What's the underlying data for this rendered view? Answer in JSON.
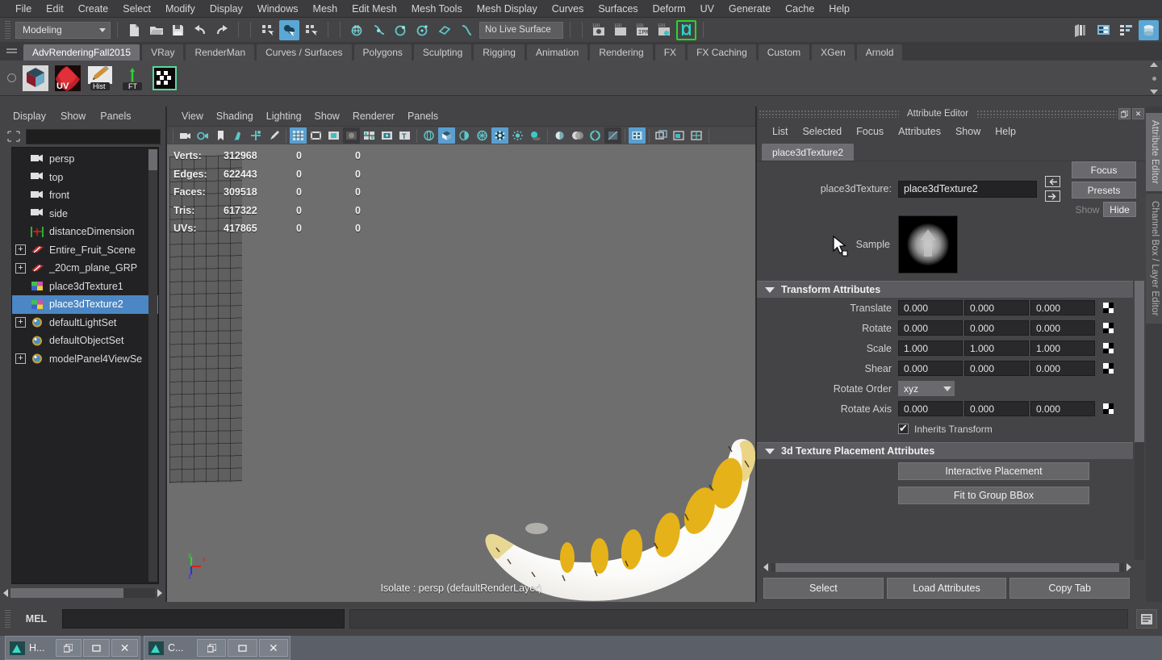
{
  "menubar": {
    "items": [
      "File",
      "Edit",
      "Create",
      "Select",
      "Modify",
      "Display",
      "Windows",
      "Mesh",
      "Edit Mesh",
      "Mesh Tools",
      "Mesh Display",
      "Curves",
      "Surfaces",
      "Deform",
      "UV",
      "Generate",
      "Cache",
      "Help"
    ]
  },
  "statusline": {
    "mode": "Modeling",
    "live_surface": "No Live Surface",
    "icons": [
      "new-scene-icon",
      "open-scene-icon",
      "save-scene-icon",
      "undo-icon",
      "redo-icon",
      "select-by-hierarchy-icon",
      "select-by-object-icon",
      "select-by-component-icon",
      "snap-to-grid-icon",
      "snap-to-curve-icon",
      "snap-to-point-icon",
      "snap-to-projected-center-icon",
      "snap-to-view-plane-icon",
      "make-live-icon",
      "render-current-frame-icon",
      "render-settings-icon",
      "ipr-render-icon",
      "render-view-icon",
      "hypershade-icon",
      "toggle-sidebar-icon",
      "attribute-editor-toggle-icon",
      "channel-box-toggle-icon",
      "layer-editor-toggle-icon"
    ]
  },
  "shelf": {
    "tabs": [
      "AdvRenderingFall2015",
      "VRay",
      "RenderMan",
      "Curves / Surfaces",
      "Polygons",
      "Sculpting",
      "Rigging",
      "Animation",
      "Rendering",
      "FX",
      "FX Caching",
      "Custom",
      "XGen",
      "Arnold"
    ],
    "active_tab": "AdvRenderingFall2015",
    "buttons": [
      "cube-shader-icon",
      "uv-texture-icon",
      "hist-pencil-icon",
      "ft-axis-icon",
      "checker-texture-icon"
    ]
  },
  "outliner": {
    "menus": [
      "Display",
      "Show",
      "Panels"
    ],
    "search_value": "",
    "items": [
      {
        "label": "persp",
        "icon": "camera-icon",
        "expandable": false,
        "indent": 1,
        "selected": false
      },
      {
        "label": "top",
        "icon": "camera-icon",
        "expandable": false,
        "indent": 1,
        "selected": false
      },
      {
        "label": "front",
        "icon": "camera-icon",
        "expandable": false,
        "indent": 1,
        "selected": false
      },
      {
        "label": "side",
        "icon": "camera-icon",
        "expandable": false,
        "indent": 1,
        "selected": false
      },
      {
        "label": "distanceDimension",
        "icon": "distance-dimension-icon",
        "expandable": false,
        "indent": 1,
        "selected": false
      },
      {
        "label": "Entire_Fruit_Scene",
        "icon": "transform-group-icon",
        "expandable": true,
        "indent": 0,
        "selected": false
      },
      {
        "label": "_20cm_plane_GRP",
        "icon": "transform-group-icon",
        "expandable": true,
        "indent": 0,
        "selected": false
      },
      {
        "label": "place3dTexture1",
        "icon": "place3d-texture-icon",
        "expandable": false,
        "indent": 1,
        "selected": false
      },
      {
        "label": "place3dTexture2",
        "icon": "place3d-texture-icon",
        "expandable": false,
        "indent": 1,
        "selected": true
      },
      {
        "label": "defaultLightSet",
        "icon": "set-icon",
        "expandable": true,
        "indent": 0,
        "selected": false
      },
      {
        "label": "defaultObjectSet",
        "icon": "set-icon",
        "expandable": false,
        "indent": 1,
        "selected": false
      },
      {
        "label": "modelPanel4ViewSe",
        "icon": "set-icon",
        "expandable": true,
        "indent": 0,
        "selected": false
      }
    ]
  },
  "viewport": {
    "menus": [
      "View",
      "Shading",
      "Lighting",
      "Show",
      "Renderer",
      "Panels"
    ],
    "hud": {
      "rows": [
        {
          "label": "Verts:",
          "v1": "312968",
          "v2": "0",
          "v3": "0"
        },
        {
          "label": "Edges:",
          "v1": "622443",
          "v2": "0",
          "v3": "0"
        },
        {
          "label": "Faces:",
          "v1": "309518",
          "v2": "0",
          "v3": "0"
        },
        {
          "label": "Tris:",
          "v1": "617322",
          "v2": "0",
          "v3": "0"
        },
        {
          "label": "UVs:",
          "v1": "417865",
          "v2": "0",
          "v3": "0"
        }
      ]
    },
    "status": "Isolate : persp (defaultRenderLayer)",
    "axis_labels": {
      "x": "x",
      "y": "y",
      "z": "z"
    },
    "toolbar_icons": [
      "camera-select-icon",
      "camera-attributes-icon",
      "bookmark-icon",
      "image-plane-icon",
      "two-d-pan-zoom-icon",
      "grease-pencil-icon",
      "grid-toggle-icon",
      "film-gate-icon",
      "resolution-gate-icon",
      "gate-mask-icon",
      "field-chart-icon",
      "safe-action-icon",
      "safe-title-icon",
      "wireframe-icon",
      "smooth-shade-icon",
      "shaded-wireframe-icon",
      "hardware-texture-icon",
      "use-default-material-icon",
      "lighting-icon",
      "shadows-icon",
      "ambient-occlusion-icon",
      "motion-blur-icon",
      "multisample-icon",
      "xray-icon",
      "isolate-select-icon",
      "panel-zoom-icon",
      "panel-layout-icon",
      "grid-view-icon"
    ]
  },
  "attribute_editor": {
    "title": "Attribute Editor",
    "menus": [
      "List",
      "Selected",
      "Focus",
      "Attributes",
      "Show",
      "Help"
    ],
    "tab": "place3dTexture2",
    "node_label": "place3dTexture:",
    "node_value": "place3dTexture2",
    "buttons": {
      "focus": "Focus",
      "presets": "Presets",
      "show": "Show",
      "hide": "Hide"
    },
    "sample_label": "Sample",
    "transform_section": "Transform Attributes",
    "transform_rows": [
      {
        "label": "Translate",
        "values": [
          "0.000",
          "0.000",
          "0.000"
        ]
      },
      {
        "label": "Rotate",
        "values": [
          "0.000",
          "0.000",
          "0.000"
        ]
      },
      {
        "label": "Scale",
        "values": [
          "1.000",
          "1.000",
          "1.000"
        ]
      },
      {
        "label": "Shear",
        "values": [
          "0.000",
          "0.000",
          "0.000"
        ]
      }
    ],
    "rotate_order_label": "Rotate Order",
    "rotate_order_value": "xyz",
    "rotate_axis_label": "Rotate Axis",
    "rotate_axis_values": [
      "0.000",
      "0.000",
      "0.000"
    ],
    "inherits_transform_label": "Inherits Transform",
    "inherits_transform_checked": true,
    "placement_section": "3d Texture Placement Attributes",
    "placement_buttons": [
      "Interactive Placement",
      "Fit to Group BBox"
    ],
    "bottom_buttons": [
      "Select",
      "Load Attributes",
      "Copy Tab"
    ],
    "side_tabs": [
      {
        "label": "Attribute Editor",
        "active": true
      },
      {
        "label": "Channel Box / Layer Editor",
        "active": false
      }
    ]
  },
  "command_line": {
    "language": "MEL",
    "input_value": "",
    "output_value": ""
  },
  "taskbar": {
    "windows": [
      {
        "label": "H...",
        "icon": "maya-window-icon",
        "buttons": [
          "restore-icon",
          "maximize-icon",
          "close-icon"
        ]
      },
      {
        "label": "C...",
        "icon": "maya-window-icon",
        "buttons": [
          "restore-icon",
          "maximize-icon",
          "close-icon"
        ]
      }
    ]
  },
  "colors": {
    "accent_blue": "#5aa7d6",
    "selection_blue": "#4b87c4",
    "panel_bg": "#444446",
    "viewport_bg": "#6e6e6e",
    "banana_yellow": "#e8b41c"
  }
}
